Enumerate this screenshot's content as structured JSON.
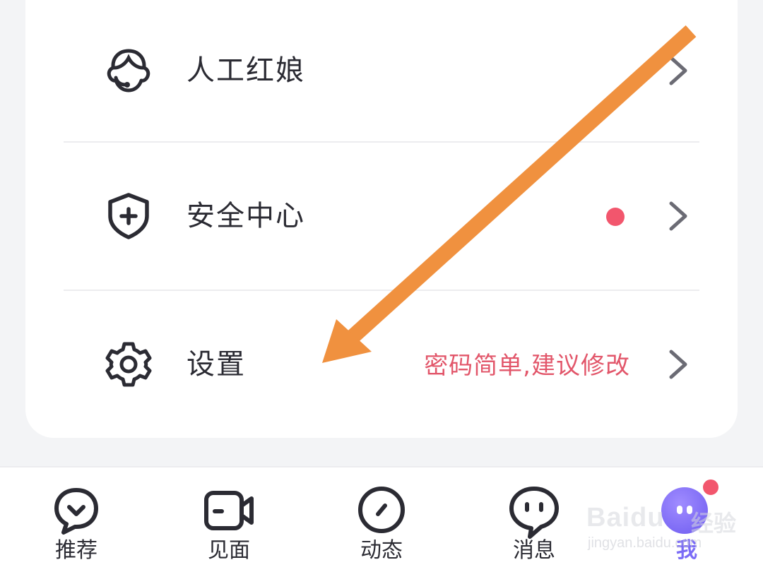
{
  "menu": {
    "items": [
      {
        "label": "人工红娘",
        "icon": "matchmaker-headset-icon"
      },
      {
        "label": "安全中心",
        "icon": "shield-plus-icon",
        "has_red_dot": true
      },
      {
        "label": "设置",
        "icon": "gear-icon",
        "hint": "密码简单,建议修改"
      }
    ]
  },
  "tabbar": {
    "tabs": [
      {
        "label": "推荐",
        "icon": "heart-chat-icon"
      },
      {
        "label": "见面",
        "icon": "video-camera-icon"
      },
      {
        "label": "动态",
        "icon": "compass-icon"
      },
      {
        "label": "消息",
        "icon": "chat-bubble-icon"
      },
      {
        "label": "我",
        "icon": "avatar-icon",
        "active": true,
        "has_badge": true
      }
    ]
  },
  "watermark": {
    "logo_text": "Baidu",
    "suffix": "经验",
    "url": "jingyan.baidu.com"
  },
  "colors": {
    "text": "#2b2b33",
    "chevron": "#6b6b74",
    "hint_red": "#e2566a",
    "dot_red": "#f2566d",
    "active_purple": "#7b6cf6",
    "arrow_orange": "#f0913f",
    "divider": "#ececef",
    "background": "#f3f4f6"
  }
}
